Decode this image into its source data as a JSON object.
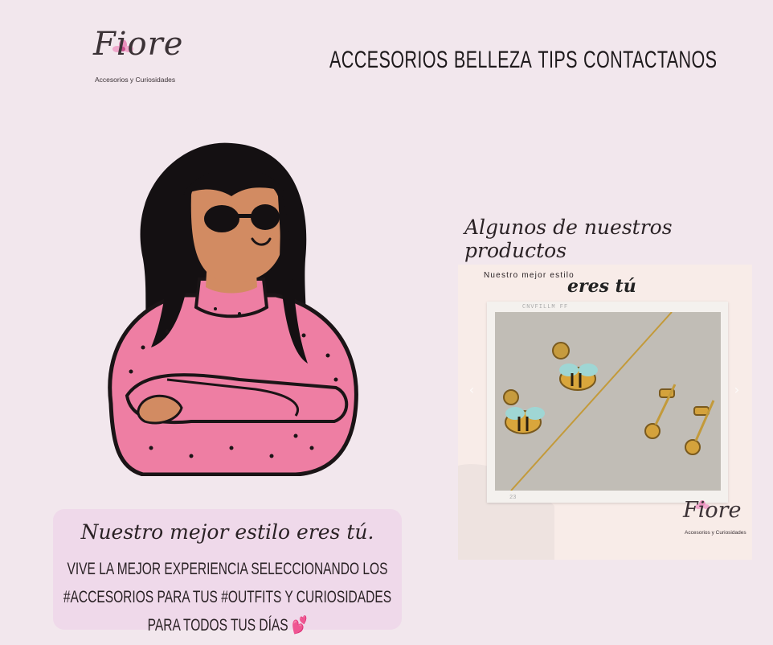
{
  "brand": {
    "name": "Fiore",
    "tagline": "Accesorios y Curiosidades"
  },
  "nav": {
    "items": [
      "ACCESORIOS",
      "BELLEZA",
      "TIPS",
      "CONTACTANOS"
    ]
  },
  "products": {
    "title": "Algunos de nuestros productos",
    "card": {
      "tag": "Nuestro mejor estilo",
      "headline": "eres tú",
      "photo_code": "CNVFILLM FF",
      "photo_number": "23",
      "logo_name": "Fiore",
      "logo_tagline": "Accesorios y Curiosidades"
    }
  },
  "promo": {
    "title": "Nuestro mejor estilo eres tú.",
    "text": "VIVE LA MEJOR EXPERIENCIA SELECCIONANDO LOS #ACCESORIOS PARA TUS #OUTFITS Y CURIOSIDADES PARA TODOS TUS DÍAS",
    "emoji": "💕"
  },
  "colors": {
    "background": "#f2e7ed",
    "promo_bg": "#efd9ea",
    "sweater": "#ee7ea3",
    "accent_pink": "#e8457f"
  },
  "icons": [
    "flower-icon",
    "chevron-left-icon",
    "chevron-right-icon",
    "heart-icon"
  ]
}
